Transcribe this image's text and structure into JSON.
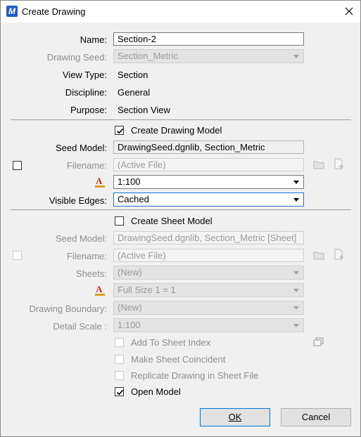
{
  "window": {
    "title": "Create Drawing",
    "app_icon_letter": "M"
  },
  "drawing": {
    "name_label": "Name:",
    "name_value": "Section-2",
    "seed_label": "Drawing Seed:",
    "seed_value": "Section_Metric",
    "view_type_label": "View Type:",
    "view_type_value": "Section",
    "discipline_label": "Discipline:",
    "discipline_value": "General",
    "purpose_label": "Purpose:",
    "purpose_value": "Section View"
  },
  "drawing_model": {
    "create_label": "Create Drawing Model",
    "create_checked": true,
    "seed_model_label": "Seed Model:",
    "seed_model_value": "DrawingSeed.dgnlib, Section_Metric",
    "filename_label": "Filename:",
    "filename_value": "(Active File)",
    "filename_checked": false,
    "scale_value": "1:100",
    "visible_edges_label": "Visible Edges:",
    "visible_edges_value": "Cached"
  },
  "sheet_model": {
    "create_label": "Create Sheet Model",
    "create_checked": false,
    "seed_model_label": "Seed Model:",
    "seed_model_value": "DrawingSeed.dgnlib, Section_Metric [Sheet]",
    "filename_label": "Filename:",
    "filename_value": "(Active File)",
    "sheets_label": "Sheets:",
    "sheets_value": "(New)",
    "scale_value": "Full Size 1 = 1",
    "boundary_label": "Drawing Boundary:",
    "boundary_value": "(New)",
    "detail_scale_label": "Detail Scale :",
    "detail_scale_value": "1:100"
  },
  "options": {
    "add_to_index": "Add To Sheet Index",
    "make_coincident": "Make Sheet Coincident",
    "replicate": "Replicate Drawing in Sheet File",
    "open_model": "Open Model",
    "open_model_checked": true
  },
  "buttons": {
    "ok_label": "OK",
    "cancel_label": "Cancel"
  }
}
